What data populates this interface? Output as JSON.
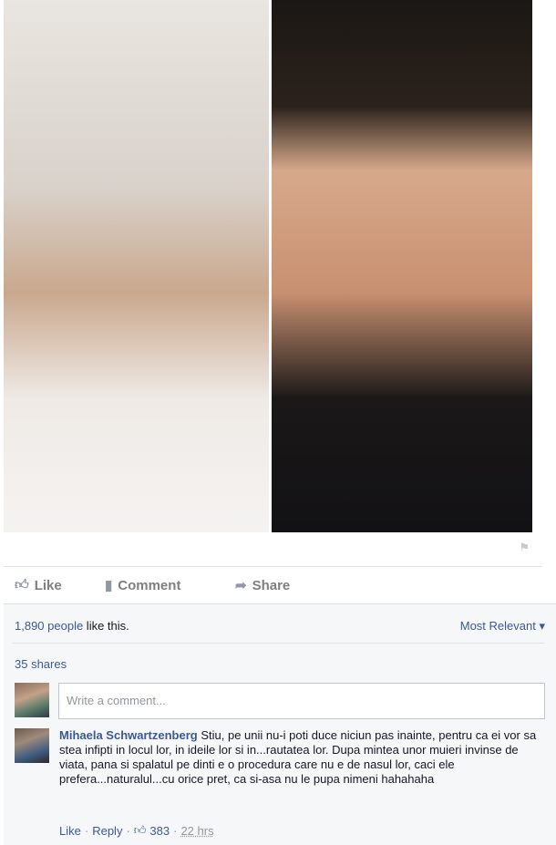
{
  "post": {
    "photo_left_alt": "",
    "photo_right_alt": ""
  },
  "actions": {
    "like_label": "Like",
    "comment_label": "Comment",
    "share_label": "Share"
  },
  "feedback": {
    "likes_count": "1,890 people",
    "likes_suffix": " like this.",
    "sort_label": "Most Relevant",
    "shares_label": "35 shares",
    "comment_placeholder": "Write a comment..."
  },
  "comment": {
    "author": "Mihaela Schwartzenberg",
    "text": "Stiu, pe unii nu-i poti duce niciun pas inainte, pentru ca ei vor sa stea infipti in locul lor, in ideile lor si in...rautatea lor. Dupa mintea unor muieri invinse de viata, pana si spalatul pe dinti e o procedura care nu e de nasul lor, caci ele prefera...naturalul...cu orice pret, ca si-asa nu le pupa nimeni hahahaha",
    "like_label": "Like",
    "reply_label": "Reply",
    "like_count": "383",
    "time": "22 hrs"
  },
  "icons": {
    "like": "thumbs-up-icon",
    "comment": "speech-bubble-icon",
    "share": "share-arrow-icon",
    "flag": "flag-icon",
    "dropdown": "caret-down-icon"
  }
}
